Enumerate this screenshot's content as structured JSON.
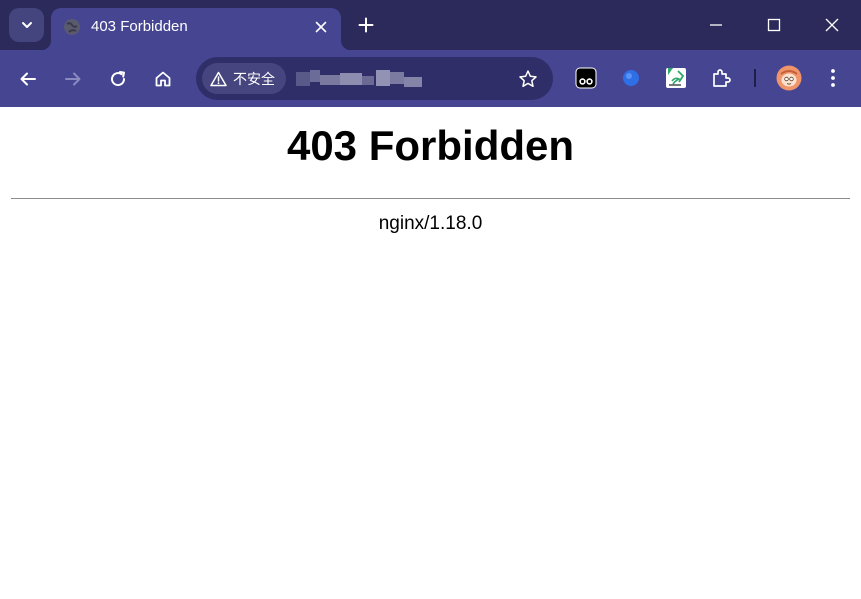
{
  "tab": {
    "title": "403 Forbidden",
    "favicon": "globe-icon"
  },
  "address_bar": {
    "security_label": "不安全",
    "security_icon": "warning-triangle-icon",
    "url": "(obscured)"
  },
  "page": {
    "heading": "403 Forbidden",
    "footer": "nginx/1.18.0"
  },
  "colors": {
    "titlebar": "#2c2a5a",
    "toolbar": "#454592",
    "omnibox": "#2f2e68",
    "profile_avatar": "#f0946a"
  }
}
